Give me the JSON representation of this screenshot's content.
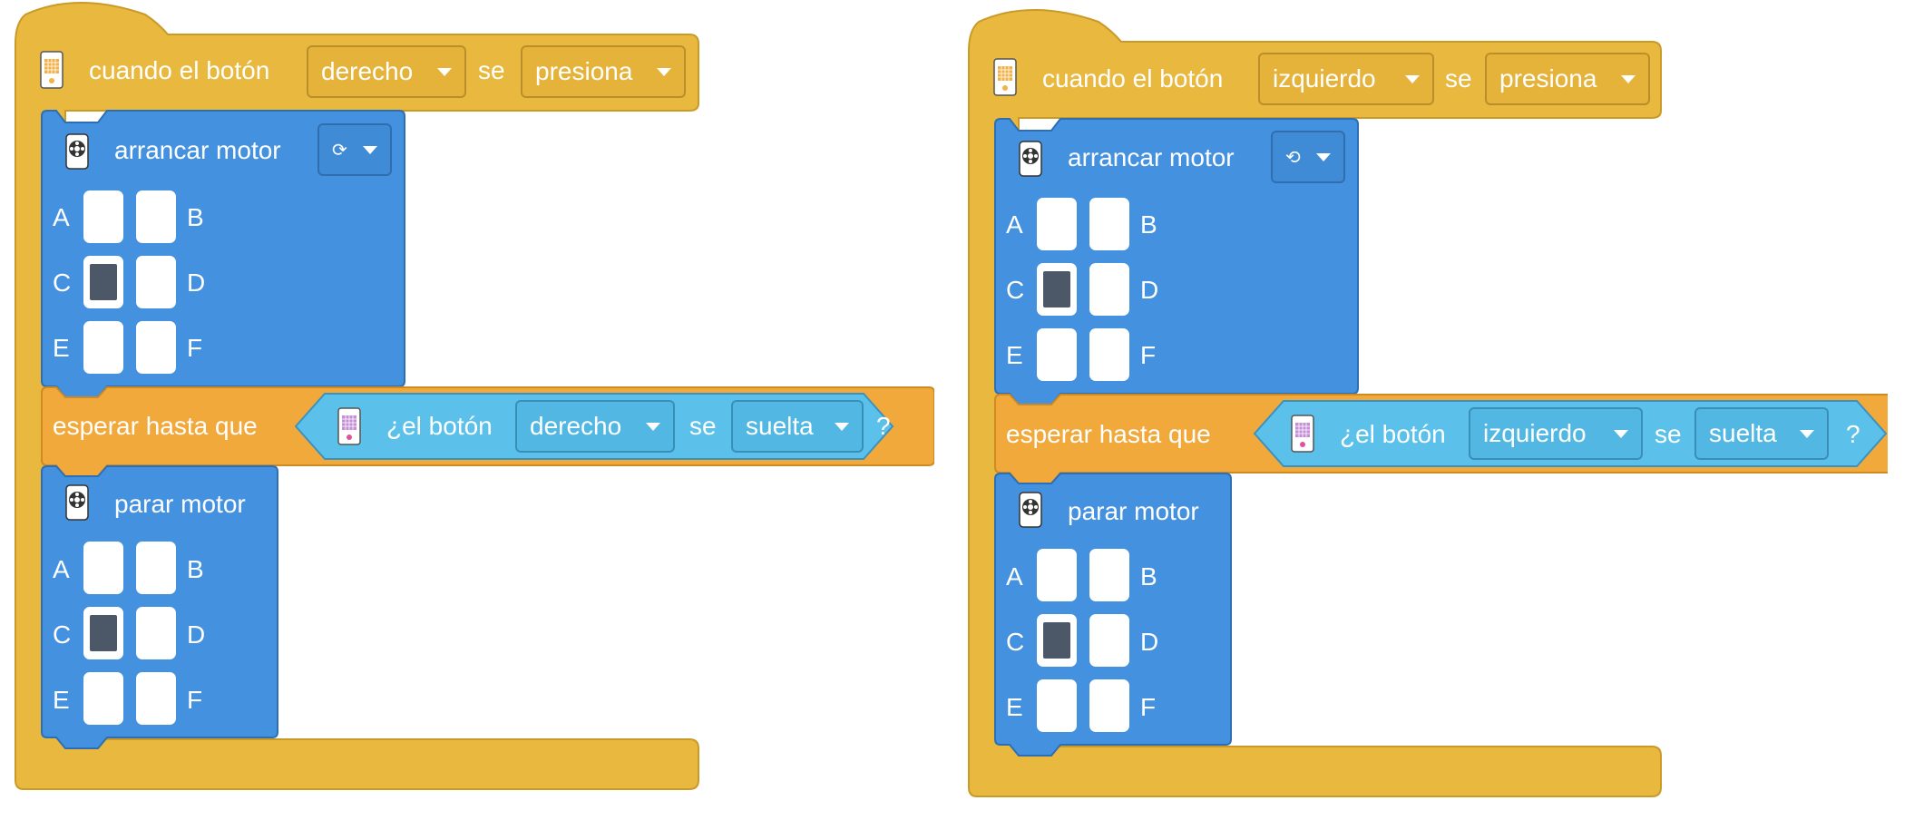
{
  "scripts": [
    {
      "event": {
        "label": "cuando el botón",
        "button": "derecho",
        "se": "se",
        "action": "presiona"
      },
      "start_motor": {
        "label": "arrancar motor",
        "direction": "⟳"
      },
      "start_ports": {
        "A": "A",
        "B": "B",
        "C": "C",
        "D": "D",
        "E": "E",
        "F": "F",
        "selected": "C"
      },
      "wait": {
        "label": "esperar hasta que",
        "question": "¿el botón",
        "button": "derecho",
        "se": "se",
        "state": "suelta",
        "qmark": "?"
      },
      "stop_motor": {
        "label": "parar motor"
      },
      "stop_ports": {
        "A": "A",
        "B": "B",
        "C": "C",
        "D": "D",
        "E": "E",
        "F": "F",
        "selected": "C"
      }
    },
    {
      "event": {
        "label": "cuando el botón",
        "button": "izquierdo",
        "se": "se",
        "action": "presiona"
      },
      "start_motor": {
        "label": "arrancar motor",
        "direction": "⟲"
      },
      "start_ports": {
        "A": "A",
        "B": "B",
        "C": "C",
        "D": "D",
        "E": "E",
        "F": "F",
        "selected": "C"
      },
      "wait": {
        "label": "esperar hasta que",
        "question": "¿el botón",
        "button": "izquierdo",
        "se": "se",
        "state": "suelta",
        "qmark": "?"
      },
      "stop_motor": {
        "label": "parar motor"
      },
      "stop_ports": {
        "A": "A",
        "B": "B",
        "C": "C",
        "D": "D",
        "E": "E",
        "F": "F",
        "selected": "C"
      }
    }
  ],
  "colors": {
    "event_block": "#e9b93f",
    "event_border": "#c99a28",
    "motor_block": "#4491e0",
    "motor_border": "#2e6fb3",
    "control_block": "#f2a93b",
    "control_border": "#d08a22",
    "sensor_block": "#5bc0ea",
    "sensor_border": "#3b92bf",
    "port_selected": "#4c5867"
  },
  "icons": {
    "hub": "hub-icon",
    "motor": "motor-icon",
    "dropdown": "dropdown-arrow-icon"
  }
}
